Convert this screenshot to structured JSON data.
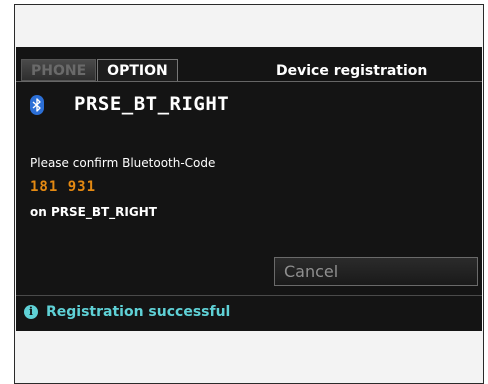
{
  "tabs": [
    {
      "label": "PHONE",
      "active": false
    },
    {
      "label": "OPTION",
      "active": true
    }
  ],
  "header": {
    "title": "Device registration"
  },
  "device": {
    "name": "PRSE_BT_RIGHT",
    "icon": "bluetooth-icon"
  },
  "pairing": {
    "prompt": "Please confirm Bluetooth-Code",
    "code": "181 931",
    "target": "on PRSE_BT_RIGHT"
  },
  "actions": {
    "cancel_label": "Cancel"
  },
  "status": {
    "icon": "info-icon",
    "text": "Registration successful"
  },
  "colors": {
    "screen_bg": "#141414",
    "code_orange": "#e58a12",
    "status_cyan": "#5fd1d6",
    "bluetooth_blue": "#2c6fd6"
  }
}
